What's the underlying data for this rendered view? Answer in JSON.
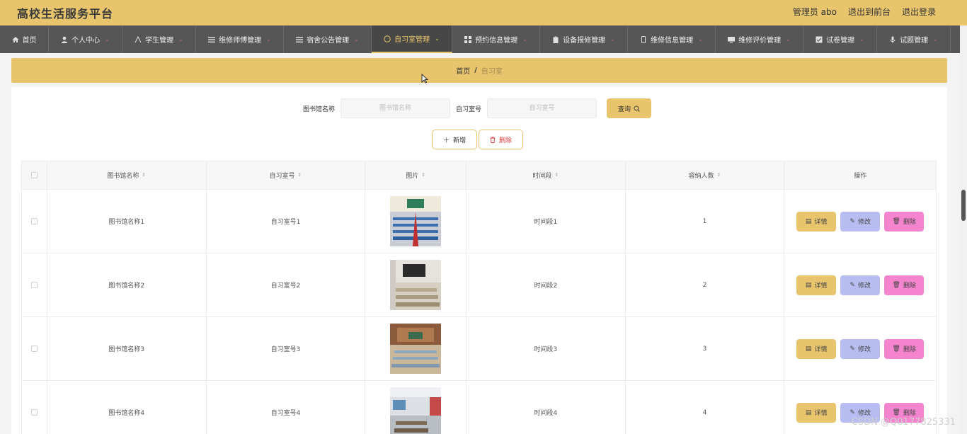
{
  "header": {
    "title": "高校生活服务平台",
    "user_label": "管理员 abo",
    "front_link": "退出到前台",
    "logout_link": "退出登录"
  },
  "nav": [
    {
      "label": "首页",
      "icon": "home-icon",
      "caret": false,
      "active": false
    },
    {
      "label": "个人中心",
      "icon": "user-icon",
      "caret": true,
      "active": false
    },
    {
      "label": "学生管理",
      "icon": "student-icon",
      "caret": true,
      "active": false
    },
    {
      "label": "维修师傅管理",
      "icon": "list-icon",
      "caret": true,
      "active": false
    },
    {
      "label": "宿舍公告管理",
      "icon": "menu-icon",
      "caret": true,
      "active": false
    },
    {
      "label": "自习室管理",
      "icon": "compass-icon",
      "caret": true,
      "active": true
    },
    {
      "label": "预约信息管理",
      "icon": "grid-icon",
      "caret": true,
      "active": false
    },
    {
      "label": "设备报修管理",
      "icon": "clipboard-icon",
      "caret": true,
      "active": false
    },
    {
      "label": "维修信息管理",
      "icon": "phone-icon",
      "caret": true,
      "active": false
    },
    {
      "label": "维修评价管理",
      "icon": "monitor-icon",
      "caret": true,
      "active": false
    },
    {
      "label": "试卷管理",
      "icon": "check-icon",
      "caret": true,
      "active": false
    },
    {
      "label": "试题管理",
      "icon": "mic-icon",
      "caret": true,
      "active": false
    }
  ],
  "breadcrumb": {
    "home": "首页",
    "separator": "/",
    "current": "自习室"
  },
  "search": {
    "library_label": "图书馆名称",
    "library_placeholder": "图书馆名称",
    "room_label": "自习室号",
    "room_placeholder": "自习室号",
    "query_button": "查询"
  },
  "actions": {
    "add": "新增",
    "delete": "删除"
  },
  "table": {
    "columns": [
      "图书馆名称",
      "自习室号",
      "图片",
      "时间段",
      "容纳人数",
      "操作"
    ],
    "rows": [
      {
        "library": "图书馆名称1",
        "room": "自习室号1",
        "period": "时间段1",
        "capacity": "1"
      },
      {
        "library": "图书馆名称2",
        "room": "自习室号2",
        "period": "时间段2",
        "capacity": "2"
      },
      {
        "library": "图书馆名称3",
        "room": "自习室号3",
        "period": "时间段3",
        "capacity": "3"
      },
      {
        "library": "图书馆名称4",
        "room": "自习室号4",
        "period": "时间段4",
        "capacity": "4"
      }
    ],
    "row_buttons": {
      "detail": "详情",
      "edit": "修改",
      "remove": "删除"
    }
  },
  "watermark": "CSDN @Q0177825331",
  "colors": {
    "accent": "#e8c56d",
    "nav_bg": "#565656",
    "detail": "#e8c56d",
    "edit": "#b7bdf0",
    "remove": "#f484cd"
  }
}
